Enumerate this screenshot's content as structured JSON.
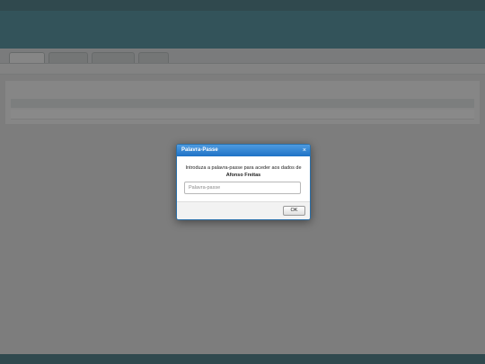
{
  "dialog": {
    "title": "Palavra-Passe",
    "close_symbol": "×",
    "message": "Introduza a palavra-passe para aceder aos dados de",
    "student_name": "Afonso Freitas",
    "password_placeholder": "Palavra-passe",
    "ok_label": "OK"
  },
  "colors": {
    "header": "#176a7d",
    "dialog_title": "#1f72c6",
    "overlay": "#464646"
  }
}
